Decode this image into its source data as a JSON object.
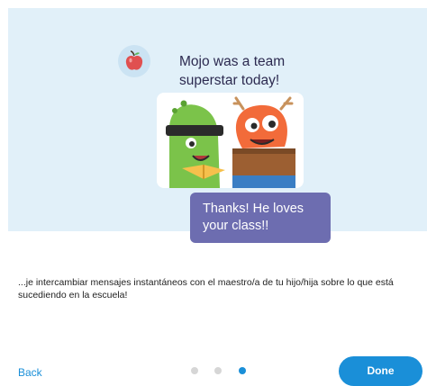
{
  "hero": {
    "avatar_icon": "apple-icon",
    "headline": "Mojo was a team superstar today!",
    "illustration": "two-monsters-reading-illustration",
    "reply_bubble": "Thanks! He loves your class!!"
  },
  "description": "...je intercambiar mensajes instantáneos con el maestro/a de tu hijo/hija sobre lo que está sucediendo en la escuela!",
  "footer": {
    "back_label": "Back",
    "done_label": "Done",
    "pagination": {
      "total": 3,
      "active": 3
    }
  },
  "colors": {
    "accent": "#1a8fd8",
    "hero_background": "#e1f0f9",
    "bubble": "#6d6db0",
    "inactive_dot": "#d6d6d6"
  }
}
